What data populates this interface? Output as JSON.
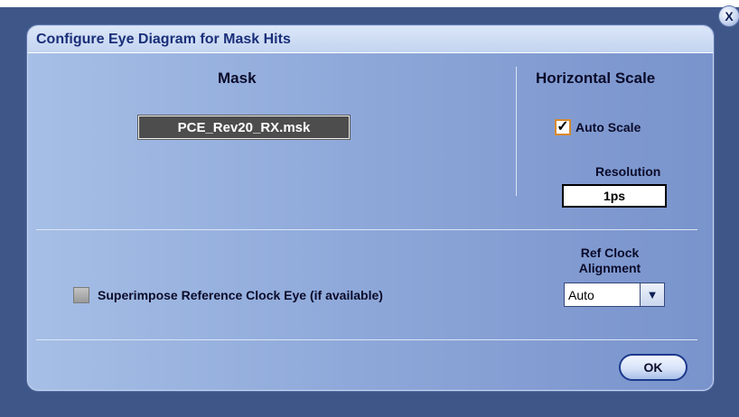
{
  "dialog": {
    "title": "Configure Eye Diagram for Mask Hits",
    "close_label": "X",
    "mask": {
      "heading": "Mask",
      "file": "PCE_Rev20_RX.msk"
    },
    "horizontal_scale": {
      "heading": "Horizontal Scale",
      "auto_scale_label": "Auto Scale",
      "auto_scale_checked": true,
      "check_mark": "✓",
      "resolution_label": "Resolution",
      "resolution_value": "1ps"
    },
    "superimpose": {
      "label": "Superimpose Reference Clock Eye (if available)",
      "checked": false
    },
    "ref_clock": {
      "label": "Ref Clock Alignment",
      "selected": "Auto",
      "arrow": "▼"
    },
    "ok_label": "OK"
  },
  "colors": {
    "title_text": "#1a2f79",
    "checkbox_accent": "#d78a2c",
    "button_border": "#1c3a8c"
  },
  "icons": {
    "close": "close-icon",
    "dropdown": "chevron-down-icon",
    "check": "checkmark-icon"
  }
}
